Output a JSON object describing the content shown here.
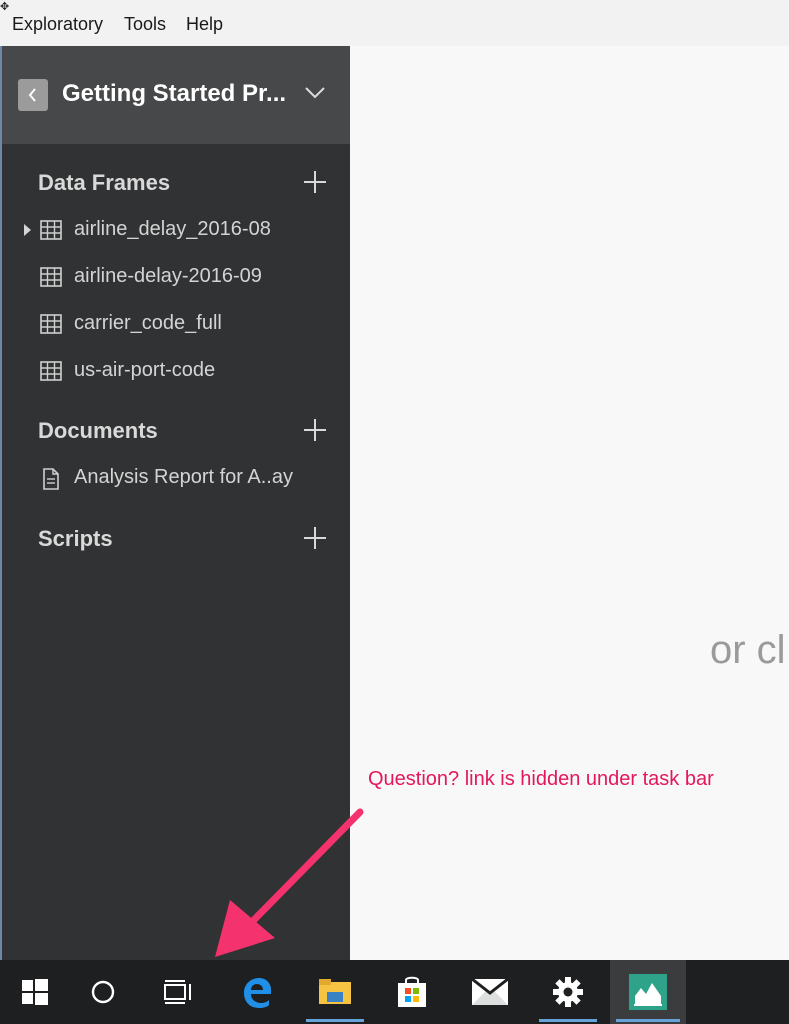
{
  "menu": {
    "items": [
      "Exploratory",
      "Tools",
      "Help"
    ]
  },
  "sidebar": {
    "project_title": "Getting Started Pr...",
    "sections": {
      "data_frames": {
        "title": "Data Frames",
        "items": [
          "airline_delay_2016-08",
          "airline-delay-2016-09",
          "carrier_code_full",
          "us-air-port-code"
        ]
      },
      "documents": {
        "title": "Documents",
        "items": [
          "Analysis Report for A..ay"
        ]
      },
      "scripts": {
        "title": "Scripts"
      }
    }
  },
  "main": {
    "hint": "or cl"
  },
  "annotation": {
    "text": "Question? link is hidden under task bar",
    "color": "#e3185a"
  },
  "taskbar": {
    "icons": [
      "windows-start-icon",
      "cortana-icon",
      "task-view-icon",
      "edge-icon",
      "file-explorer-icon",
      "store-icon",
      "mail-icon",
      "settings-icon",
      "exploratory-app-icon"
    ]
  },
  "colors": {
    "sidebar_bg": "#313233",
    "header_bg": "#474849",
    "taskbar_bg": "#1e1f20",
    "accent": "#67a3d9"
  }
}
